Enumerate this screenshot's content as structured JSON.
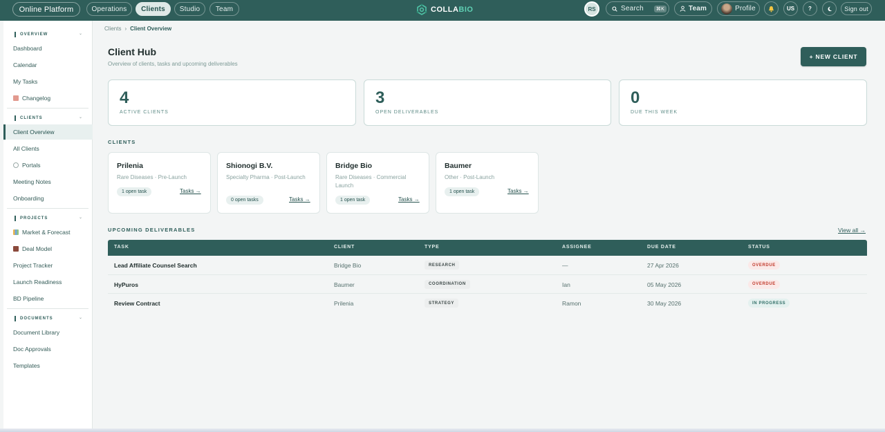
{
  "topbar": {
    "brand_label": "Online Platform",
    "nav": [
      "Operations",
      "Clients",
      "Studio",
      "Team"
    ],
    "active_nav": "Clients",
    "logo_main": "COLLA",
    "logo_accent": "BIO",
    "avatar_initials": "RS",
    "search_label": "Search",
    "search_shortcut": "⌘K",
    "team_label": "Team",
    "profile_label": "Profile",
    "help_label": "?",
    "locale_label": "US",
    "sign_out_label": "Sign out"
  },
  "sidebar": {
    "sections": [
      {
        "title": "OVERVIEW",
        "items": [
          "Dashboard",
          "Calendar",
          "My Tasks",
          "Changelog"
        ]
      },
      {
        "title": "CLIENTS",
        "items": [
          "Client Overview",
          "All Clients",
          "Portals",
          "Meeting Notes",
          "Onboarding"
        ]
      },
      {
        "title": "PROJECTS",
        "items": [
          "Market & Forecast",
          "Deal Model",
          "Project Tracker",
          "Launch Readiness",
          "BD Pipeline"
        ]
      },
      {
        "title": "DOCUMENTS",
        "items": [
          "Document Library",
          "Doc Approvals",
          "Templates"
        ]
      }
    ],
    "active_item": "Client Overview"
  },
  "breadcrumb": {
    "parent": "Clients",
    "separator": "›",
    "current": "Client Overview"
  },
  "header": {
    "title": "Client Hub",
    "subtitle": "Overview of clients, tasks and upcoming deliverables",
    "new_client_label": "+ NEW CLIENT"
  },
  "stats": [
    {
      "value": "4",
      "label": "ACTIVE CLIENTS"
    },
    {
      "value": "3",
      "label": "OPEN DELIVERABLES"
    },
    {
      "value": "0",
      "label": "DUE THIS WEEK"
    }
  ],
  "clients_section_title": "CLIENTS",
  "clients": [
    {
      "name": "Prilenia",
      "meta": "Rare Diseases · Pre-Launch",
      "open_tasks": "1 open task",
      "tasks_link": "Tasks →"
    },
    {
      "name": "Shionogi B.V.",
      "meta": "Specialty Pharma · Post-Launch",
      "open_tasks": "0 open tasks",
      "tasks_link": "Tasks →"
    },
    {
      "name": "Bridge Bio",
      "meta": "Rare Diseases · Commercial Launch",
      "open_tasks": "1 open task",
      "tasks_link": "Tasks →"
    },
    {
      "name": "Baumer",
      "meta": "Other · Post-Launch",
      "open_tasks": "1 open task",
      "tasks_link": "Tasks →"
    }
  ],
  "deliverables": {
    "title": "UPCOMING DELIVERABLES",
    "view_all": "View all →",
    "columns": [
      "TASK",
      "CLIENT",
      "TYPE",
      "ASSIGNEE",
      "DUE DATE",
      "STATUS"
    ],
    "rows": [
      {
        "task": "Lead Affiliate Counsel Search",
        "client": "Bridge Bio",
        "type": "RESEARCH",
        "assignee": "—",
        "due": "27 Apr 2026",
        "status": "OVERDUE"
      },
      {
        "task": "HyPuros",
        "client": "Baumer",
        "type": "COORDINATION",
        "assignee": "Ian",
        "due": "05 May 2026",
        "status": "OVERDUE"
      },
      {
        "task": "Review Contract",
        "client": "Prilenia",
        "type": "STRATEGY",
        "assignee": "Ramon",
        "due": "30 May 2026",
        "status": "IN PROGRESS"
      }
    ]
  },
  "colors": {
    "primary": "#2f5e5a",
    "overdue": "#c0392b",
    "in_progress": "#2f6e66"
  }
}
